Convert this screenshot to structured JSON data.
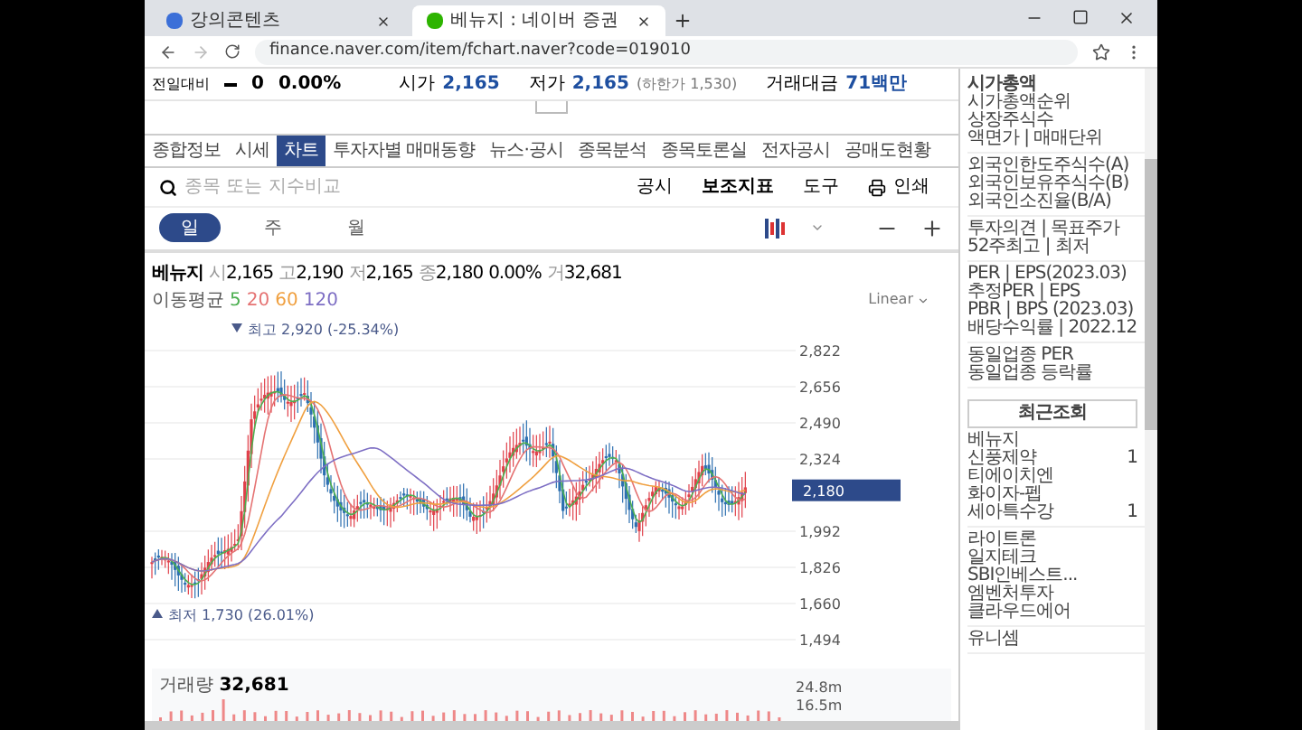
{
  "browser": {
    "tabs": [
      {
        "title": "강의콘텐츠",
        "selected": false
      },
      {
        "title": "베뉴지 : 네이버 증권",
        "selected": true
      }
    ],
    "url": "finance.naver.com/item/fchart.naver?code=019010"
  },
  "quote": {
    "change_label": "전일대비",
    "change": "0",
    "rate": "0.00%",
    "items": [
      {
        "label": "시가",
        "value": "2,165"
      },
      {
        "label": "저가",
        "value": "2,165",
        "note": "(하한가 1,530)"
      },
      {
        "label": "거래대금",
        "value": "71백만"
      }
    ]
  },
  "nav_tabs": [
    {
      "label": "종합정보",
      "selected": false
    },
    {
      "label": "시세",
      "selected": false
    },
    {
      "label": "차트",
      "selected": true
    },
    {
      "label": "투자자별 매매동향",
      "selected": false
    },
    {
      "label": "뉴스·공시",
      "selected": false
    },
    {
      "label": "종목분석",
      "selected": false
    },
    {
      "label": "종목토론실",
      "selected": false
    },
    {
      "label": "전자공시",
      "selected": false
    },
    {
      "label": "공매도현황",
      "selected": false
    }
  ],
  "search": {
    "placeholder": "종목 또는 지수비교"
  },
  "tools": [
    {
      "label": "공시",
      "kind": "text"
    },
    {
      "label": "보조지표",
      "kind": "bold"
    },
    {
      "label": "도구",
      "kind": "text"
    },
    {
      "label": "인쇄",
      "kind": "print"
    }
  ],
  "periods": [
    {
      "label": "일",
      "selected": true
    },
    {
      "label": "주",
      "selected": false
    },
    {
      "label": "월",
      "selected": false
    }
  ],
  "summary": {
    "name": "베뉴지",
    "fields": [
      {
        "label": "시",
        "value": "2,165"
      },
      {
        "label": "고",
        "value": "2,190"
      },
      {
        "label": "저",
        "value": "2,165"
      },
      {
        "label": "종",
        "value": "2,180"
      },
      {
        "value": "0.00%"
      },
      {
        "label": "거",
        "value": "32,681"
      }
    ]
  },
  "moving_average": {
    "label": "이동평균",
    "lines": [
      {
        "label": "5",
        "color": "#4caf50"
      },
      {
        "label": "20",
        "color": "#e57373"
      },
      {
        "label": "60",
        "color": "#f0a040"
      },
      {
        "label": "120",
        "color": "#7e6fc4"
      }
    ]
  },
  "scale": "Linear",
  "chart": {
    "high_note": "최고 2,920 (-25.34%)",
    "low_note": "최저 1,730 (26.01%)",
    "price_axis": [
      "2,822",
      "2,656",
      "2,490",
      "2,324",
      "1,992",
      "1,826",
      "1,660",
      "1,494"
    ],
    "current_price": "2,180",
    "volume_label": "거래량",
    "volume_value": "32,681",
    "volume_axis": [
      "24.8m",
      "16.5m"
    ]
  },
  "sidebar": {
    "groups": [
      [
        "시가총액",
        "시가총액순위",
        "상장주식수",
        "액면가 | 매매단위"
      ],
      [
        "외국인한도주식수(A)",
        "외국인보유주식수(B)",
        "외국인소진율(B/A)"
      ],
      [
        "투자의견 | 목표주가",
        "52주최고 | 최저"
      ],
      [
        "PER | EPS(2023.03)",
        "추정PER | EPS",
        "PBR | BPS (2023.03)",
        "배당수익률 | 2022.12"
      ],
      [
        "동일업종 PER",
        "동일업종 등락률"
      ]
    ],
    "recent_tab": "최근조회",
    "recent_groups": [
      [
        {
          "name": "베뉴지"
        },
        {
          "name": "신풍제약",
          "count": "1"
        },
        {
          "name": "티에이치엔"
        },
        {
          "name": "화이자-펩"
        },
        {
          "name": "세아특수강",
          "count": "1"
        }
      ],
      [
        {
          "name": "라이트론"
        },
        {
          "name": "일지테크"
        },
        {
          "name": "SBI인베스트..."
        },
        {
          "name": "엠벤처투자"
        },
        {
          "name": "클라우드에어"
        }
      ],
      [
        {
          "name": "유니셈"
        }
      ]
    ]
  }
}
